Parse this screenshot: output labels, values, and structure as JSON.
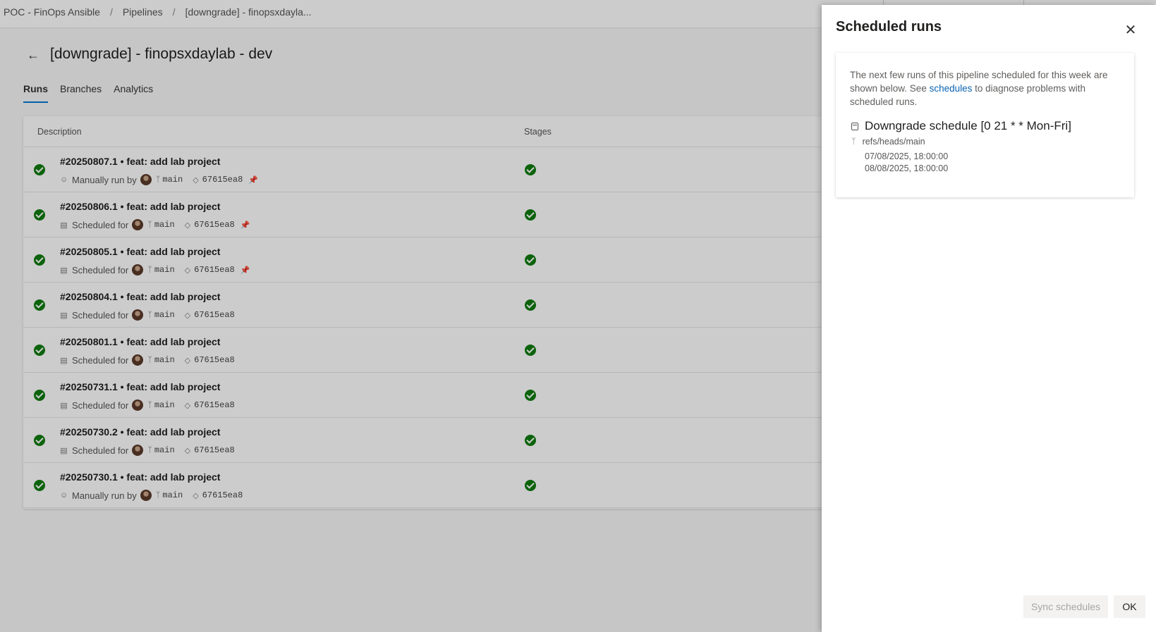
{
  "breadcrumb": {
    "items": [
      "POC - FinOps Ansible",
      "Pipelines",
      "[downgrade] - finopsxdayla..."
    ],
    "separator": "/"
  },
  "page": {
    "back_icon": "back-arrow-icon",
    "title": "[downgrade] - finopsxdaylab - dev",
    "tabs": [
      {
        "label": "Runs",
        "active": true
      },
      {
        "label": "Branches",
        "active": false
      },
      {
        "label": "Analytics",
        "active": false
      }
    ]
  },
  "runs_table": {
    "headers": {
      "description": "Description",
      "stages": "Stages"
    },
    "rows": [
      {
        "title": "#20250807.1 • feat: add lab project",
        "trigger": "Manually run by",
        "branch": "main",
        "commit": "67615ea8",
        "pinned": true
      },
      {
        "title": "#20250806.1 • feat: add lab project",
        "trigger": "Scheduled for",
        "branch": "main",
        "commit": "67615ea8",
        "pinned": true
      },
      {
        "title": "#20250805.1 • feat: add lab project",
        "trigger": "Scheduled for",
        "branch": "main",
        "commit": "67615ea8",
        "pinned": true
      },
      {
        "title": "#20250804.1 • feat: add lab project",
        "trigger": "Scheduled for",
        "branch": "main",
        "commit": "67615ea8",
        "pinned": false
      },
      {
        "title": "#20250801.1 • feat: add lab project",
        "trigger": "Scheduled for",
        "branch": "main",
        "commit": "67615ea8",
        "pinned": false
      },
      {
        "title": "#20250731.1 • feat: add lab project",
        "trigger": "Scheduled for",
        "branch": "main",
        "commit": "67615ea8",
        "pinned": false
      },
      {
        "title": "#20250730.2 • feat: add lab project",
        "trigger": "Scheduled for",
        "branch": "main",
        "commit": "67615ea8",
        "pinned": false
      },
      {
        "title": "#20250730.1 • feat: add lab project",
        "trigger": "Manually run by",
        "branch": "main",
        "commit": "67615ea8",
        "pinned": false
      }
    ]
  },
  "panel": {
    "title": "Scheduled runs",
    "close_icon": "close-icon",
    "description_before": "The next few runs of this pipeline scheduled for this week are shown below. See ",
    "description_link": "schedules",
    "description_after": " to diagnose problems with scheduled runs.",
    "schedule": {
      "name": "Downgrade schedule  [0 21 * * Mon-Fri]",
      "ref": "refs/heads/main",
      "times": [
        "07/08/2025, 18:00:00",
        "08/08/2025, 18:00:00"
      ]
    },
    "sync_label": "Sync schedules",
    "ok_label": "OK"
  },
  "colors": {
    "success": "#107c10",
    "accent": "#0078d4",
    "link": "#0a63b0"
  }
}
